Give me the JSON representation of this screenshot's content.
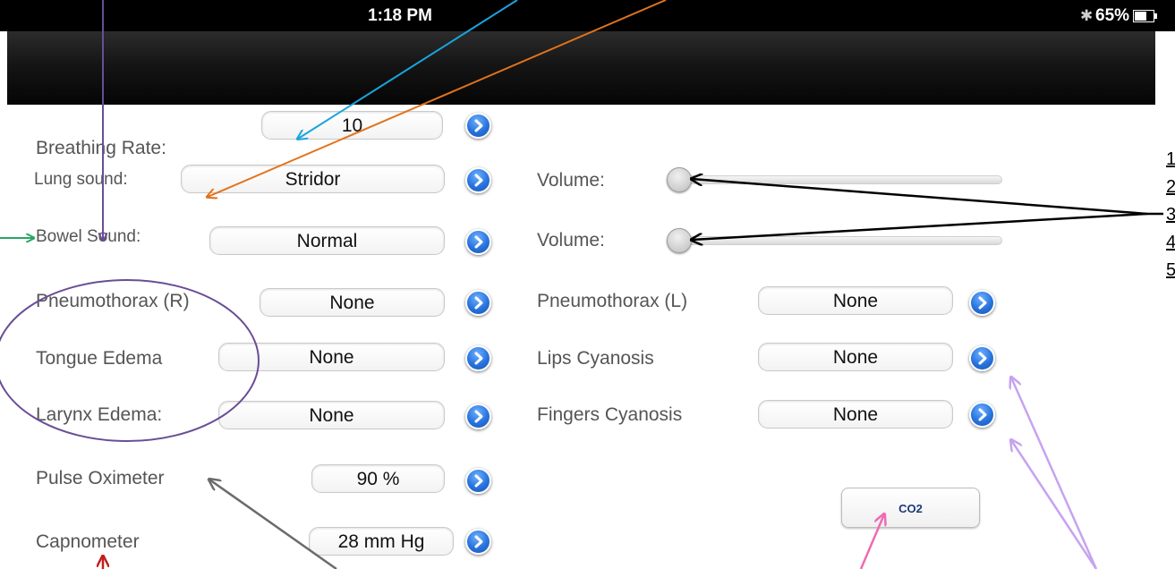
{
  "status_bar": {
    "time": "1:18 PM",
    "bluetooth_icon": "bluetooth-icon",
    "battery": "65%",
    "battery_icon": "battery-icon"
  },
  "colors": {
    "disclosure_blue": "#2773dd",
    "co2_text": "#1e3a78",
    "annotation_purple": "#6a4d96",
    "annotation_cyan": "#1aa3df",
    "annotation_orange": "#e2731c",
    "annotation_green": "#2aa564",
    "annotation_gray": "#6b6b6b",
    "annotation_pink": "#ef6ab3",
    "annotation_lilac": "#c6a3f0",
    "annotation_red": "#c11f1f"
  },
  "rows": {
    "breathing_rate": {
      "label": "Breathing Rate:",
      "value": "10"
    },
    "lung_sound": {
      "label": "Lung sound:",
      "value": "Stridor"
    },
    "bowel_sound": {
      "label": "Bowel Sound:",
      "value": "Normal"
    },
    "pneumothorax_r": {
      "label": "Pneumothorax (R)",
      "value": "None"
    },
    "tongue_edema": {
      "label": "Tongue Edema",
      "value": "None"
    },
    "larynx_edema": {
      "label": "Larynx Edema:",
      "value": "None"
    },
    "pulse_oximeter": {
      "label": "Pulse Oximeter",
      "value": "90 %"
    },
    "capnometer": {
      "label": "Capnometer",
      "value": "28 mm Hg"
    },
    "lung_volume": {
      "label": "Volume:",
      "level": 0
    },
    "bowel_volume": {
      "label": "Volume:",
      "level": 0
    },
    "pneumothorax_l": {
      "label": "Pneumothorax (L)",
      "value": "None"
    },
    "lips_cyanosis": {
      "label": "Lips Cyanosis",
      "value": "None"
    },
    "fingers_cyanosis": {
      "label": "Fingers Cyanosis",
      "value": "None"
    }
  },
  "co2_button": {
    "label": "CO2"
  },
  "edge_list": [
    "1",
    "2",
    "3",
    "4",
    "5"
  ]
}
